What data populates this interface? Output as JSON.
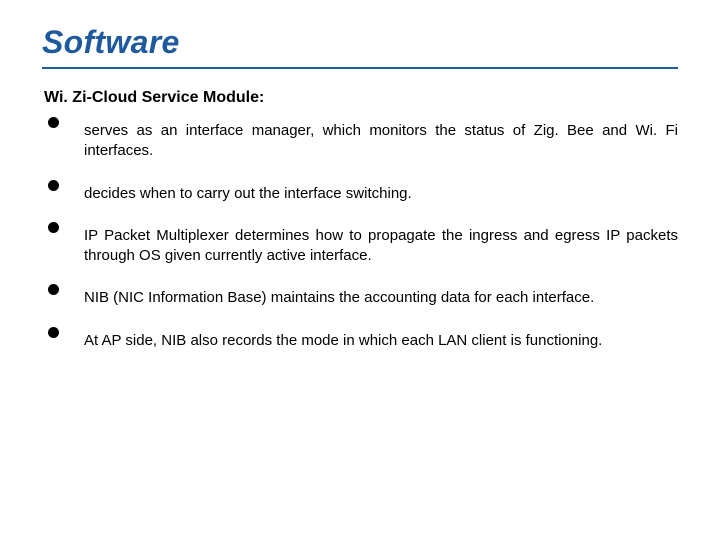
{
  "title": "Software",
  "subtitle": "Wi. Zi-Cloud Service Module:",
  "bullets": [
    "serves as an interface manager, which monitors the status of Zig. Bee and Wi. Fi interfaces.",
    "decides when to carry out the interface switching.",
    "IP Packet Multiplexer determines how to propagate the ingress and egress IP packets through OS given currently active interface.",
    "NIB (NIC Information Base) maintains the accounting data for each interface.",
    "At AP side, NIB also records the mode in which each LAN client is functioning."
  ]
}
